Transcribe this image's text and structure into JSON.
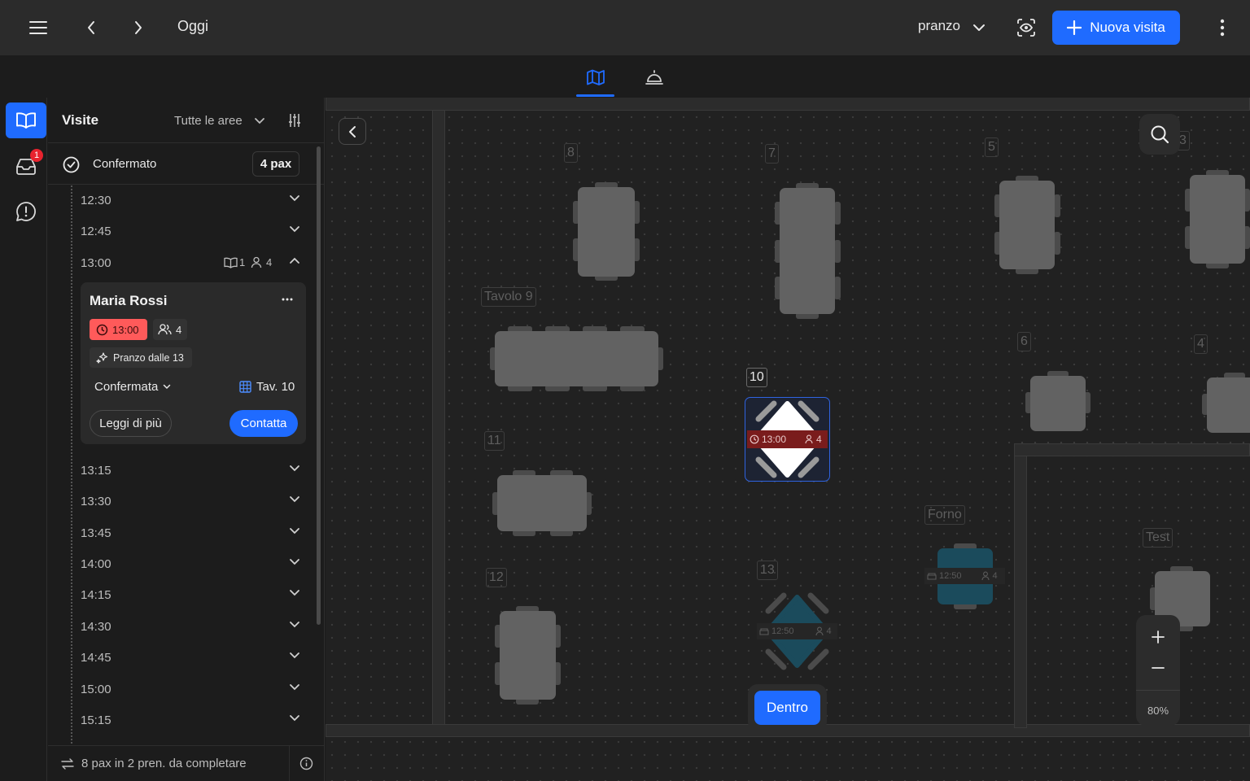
{
  "topbar": {
    "date_label": "Oggi",
    "service_label": "pranzo",
    "new_visit_label": "Nuova visita"
  },
  "rail": {
    "inbox_badge": "1"
  },
  "sidebar": {
    "title": "Visite",
    "area_filter": "Tutte le aree",
    "status_label": "Confermato",
    "pax_total": "4 pax",
    "slots_top": [
      "12:30",
      "12:45"
    ],
    "open_slot": {
      "time": "13:00",
      "bookings": "1",
      "guests": "4"
    },
    "slots_bottom": [
      "13:15",
      "13:30",
      "13:45",
      "14:00",
      "14:15",
      "14:30",
      "14:45",
      "15:00",
      "15:15"
    ],
    "footer_text": "8 pax in 2 pren. da completare"
  },
  "card": {
    "name": "Maria Rossi",
    "time": "13:00",
    "guests": "4",
    "menu": "Pranzo dalle 13",
    "status": "Confermata",
    "table": "Tav. 10",
    "more_label": "Leggi di più",
    "contact_label": "Contatta"
  },
  "map": {
    "labels": {
      "t8": "8",
      "t7": "7",
      "t5": "5",
      "t3": "3",
      "t9": "Tavolo 9",
      "t6": "6",
      "t4": "4",
      "t10": "10",
      "t11": "11",
      "t12": "12",
      "t13": "13",
      "forno": "Forno",
      "test": "Test"
    },
    "table10": {
      "time": "13:00",
      "guests": "4"
    },
    "table13": {
      "time": "12:50",
      "guests": "4"
    },
    "forno": {
      "time": "12:50",
      "guests": "4"
    },
    "zoom": "80%",
    "inside_label": "Dentro"
  },
  "colors": {
    "accent": "#1f6bff",
    "late_badge": "#ff5a5a",
    "reserved_table": "#7a1c1c",
    "seated_table": "#1b4b5c"
  }
}
